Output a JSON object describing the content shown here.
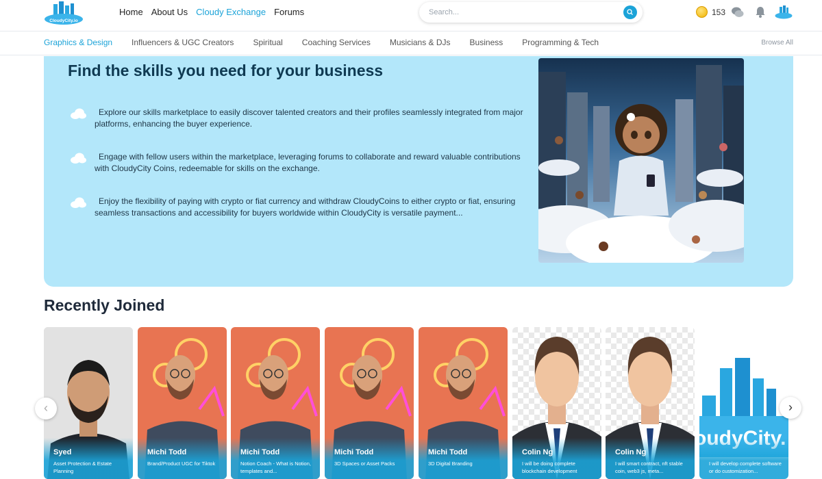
{
  "header": {
    "logo_text": "CloudyCity.io",
    "nav": [
      {
        "label": "Home",
        "active": false
      },
      {
        "label": "About Us",
        "active": false
      },
      {
        "label": "Cloudy Exchange",
        "active": true
      },
      {
        "label": "Forums",
        "active": false
      }
    ],
    "search_placeholder": "Search...",
    "coin_count": "153",
    "icons": [
      "search-icon",
      "coin-icon",
      "chat-icon",
      "bell-icon",
      "avatar"
    ]
  },
  "categories": {
    "items": [
      {
        "label": "Graphics & Design",
        "active": true
      },
      {
        "label": "Influencers & UGC Creators",
        "active": false
      },
      {
        "label": "Spiritual",
        "active": false
      },
      {
        "label": "Coaching Services",
        "active": false
      },
      {
        "label": "Musicians & DJs",
        "active": false
      },
      {
        "label": "Business",
        "active": false
      },
      {
        "label": "Programming & Tech",
        "active": false
      }
    ],
    "browse_all": "Browse All"
  },
  "hero": {
    "title": "Find the skills you need for your business",
    "features": [
      "Explore our skills marketplace to easily discover talented creators and their profiles seamlessly integrated from major platforms, enhancing the buyer experience.",
      "Engage with fellow users within the marketplace, leveraging forums to collaborate and reward valuable contributions with CloudyCity Coins, redeemable for skills on the exchange.",
      "Enjoy the flexibility of paying with crypto or fiat currency and withdraw CloudyCoins to either crypto or fiat, ensuring seamless transactions and accessibility for buyers worldwide within CloudyCity is versatile payment..."
    ]
  },
  "recently_joined": {
    "title": "Recently Joined",
    "cards": [
      {
        "name": "Syed",
        "desc": "Asset Protection & Estate Planning",
        "image": "portrait-photo"
      },
      {
        "name": "Michi Todd",
        "desc": "Brand/Product UGC for Tiktok",
        "image": "neon-portrait"
      },
      {
        "name": "Michi Todd",
        "desc": "Notion Coach - What is Notion, templates and...",
        "image": "neon-portrait"
      },
      {
        "name": "Michi Todd",
        "desc": "3D Spaces or Asset Packs",
        "image": "neon-portrait"
      },
      {
        "name": "Michi Todd",
        "desc": "3D Digital Branding",
        "image": "neon-portrait"
      },
      {
        "name": "Colin Ng",
        "desc": "I will be doing complete blockchain development",
        "image": "default-avatar"
      },
      {
        "name": "Colin Ng",
        "desc": "I will smart contract, nft stable coin, web3 js, meta...",
        "image": "default-avatar"
      },
      {
        "name": "",
        "desc": "I will develop complete software or do customization...",
        "image": "cloudycity-logo",
        "logo_text": "oudyCity."
      }
    ]
  },
  "colors": {
    "accent": "#1ba3d8",
    "hero_bg": "#b3e7fa",
    "title": "#0f3a52"
  }
}
